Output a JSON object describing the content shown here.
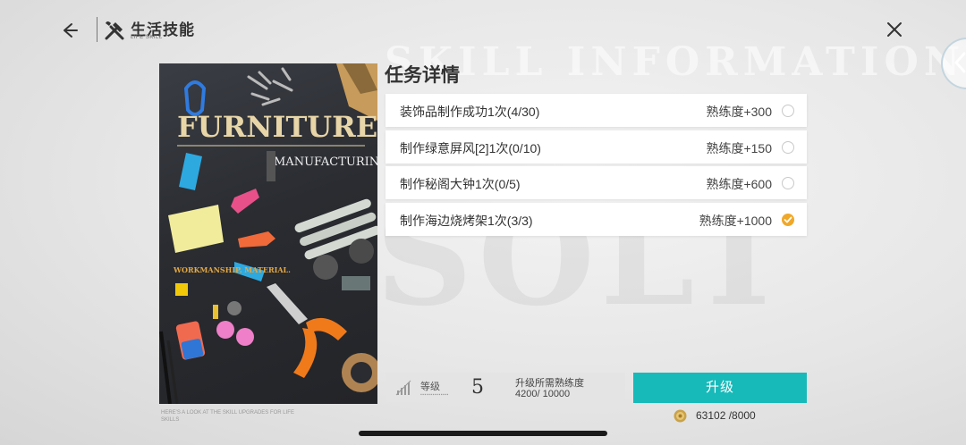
{
  "header": {
    "title": "生活技能",
    "subtitle": "LIFE SKILL"
  },
  "background_text": {
    "line1": "SKILL INFORMATION",
    "line2": "SOLT"
  },
  "poster": {
    "headline": "FURNITURE",
    "subhead": "MANUFACTURING",
    "tag": "WORKMANSHIP. MATERIAL.",
    "caption": "HERE'S A LOOK AT THE SKILL UPGRADES FOR LIFE SKILLS"
  },
  "tasks": {
    "title": "任务详情",
    "items": [
      {
        "name": "装饰品制作成功1次(4/30)",
        "reward": "熟练度+300",
        "done": false
      },
      {
        "name": "制作绿意屏风[2]1次(0/10)",
        "reward": "熟练度+150",
        "done": false
      },
      {
        "name": "制作秘阁大钟1次(0/5)",
        "reward": "熟练度+600",
        "done": false
      },
      {
        "name": "制作海边烧烤架1次(3/3)",
        "reward": "熟练度+1000",
        "done": true
      }
    ]
  },
  "level": {
    "label": "等级",
    "value": "5",
    "requirement_label": "升级所需熟练度",
    "requirement_value": "4200/ 10000"
  },
  "upgrade": {
    "label": "升级"
  },
  "coins": {
    "text": "63102 /8000"
  },
  "colors": {
    "accent": "#17b9b9",
    "check_done": "#f0a82a"
  }
}
